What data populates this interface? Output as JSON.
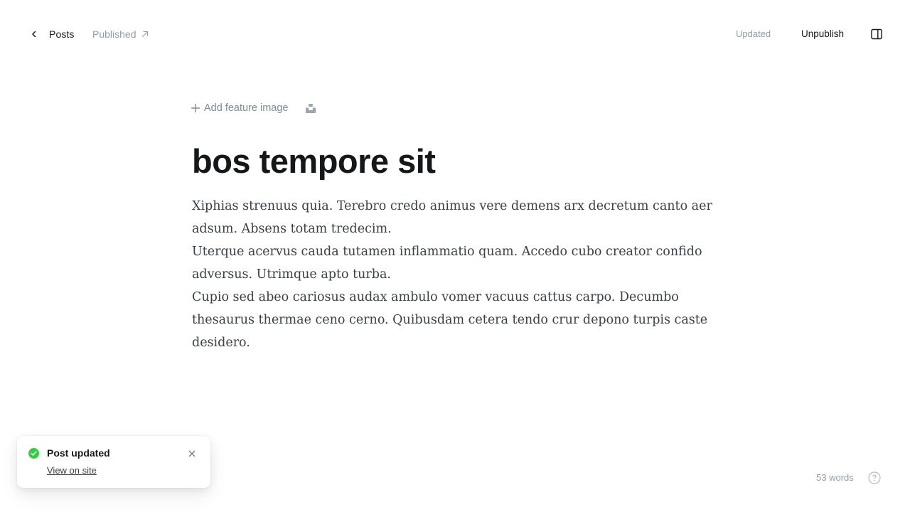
{
  "header": {
    "back_label": "Posts",
    "status_label": "Published",
    "save_status": "Updated",
    "unpublish_label": "Unpublish"
  },
  "editor": {
    "add_feature_label": "Add feature image",
    "title": "bos tempore sit",
    "paragraphs": [
      "Xiphias strenuus quia. Terebro credo animus vere demens arx decretum canto aer adsum. Absens totam tredecim.",
      "Uterque acervus cauda tutamen inflammatio quam. Accedo cubo creator confido adversus. Utrimque apto turba.",
      "Cupio sed abeo cariosus audax ambulo vomer vacuus cattus carpo. Decumbo thesaurus thermae ceno cerno. Quibusdam cetera tendo crur depono turpis caste desidero."
    ]
  },
  "toast": {
    "title": "Post updated",
    "link_label": "View on site"
  },
  "footer": {
    "word_count": "53 words"
  },
  "colors": {
    "success": "#30cf43",
    "muted": "#8e9cac",
    "text": "#15171a"
  },
  "icons": [
    "chevron-left-icon",
    "arrow-up-right-icon",
    "sidebar-toggle-icon",
    "plus-icon",
    "unsplash-icon",
    "check-circle-icon",
    "close-icon",
    "help-icon"
  ]
}
